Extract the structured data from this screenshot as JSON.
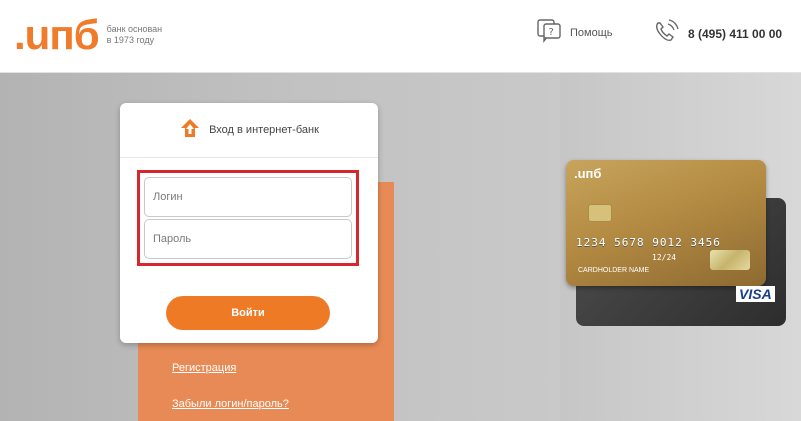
{
  "header": {
    "logo_text": ".uпб",
    "tagline_line1": "банк основан",
    "tagline_line2": "в 1973 году",
    "help_label": "Помощь",
    "phone_number": "8 (495) 411 00 00"
  },
  "login": {
    "title": "Вход в интернет-банк",
    "login_placeholder": "Логин",
    "password_placeholder": "Пароль",
    "submit_label": "Войти"
  },
  "links": {
    "register": "Регистрация",
    "forgot": "Забыли логин/пароль?"
  },
  "promo_card": {
    "brand": ".uпб",
    "number": "1234 5678 9012 3456",
    "expiry": "12/24",
    "holder": "CARDHOLDER NAME",
    "network": "VISA"
  },
  "colors": {
    "brand_orange": "#f07b2a",
    "button_orange": "#ef7a25",
    "panel_orange": "#e88a55",
    "highlight_red": "#d7262e"
  },
  "icons": {
    "help": "help-bubble-icon",
    "phone": "phone-icon",
    "login": "home-arrow-icon"
  }
}
